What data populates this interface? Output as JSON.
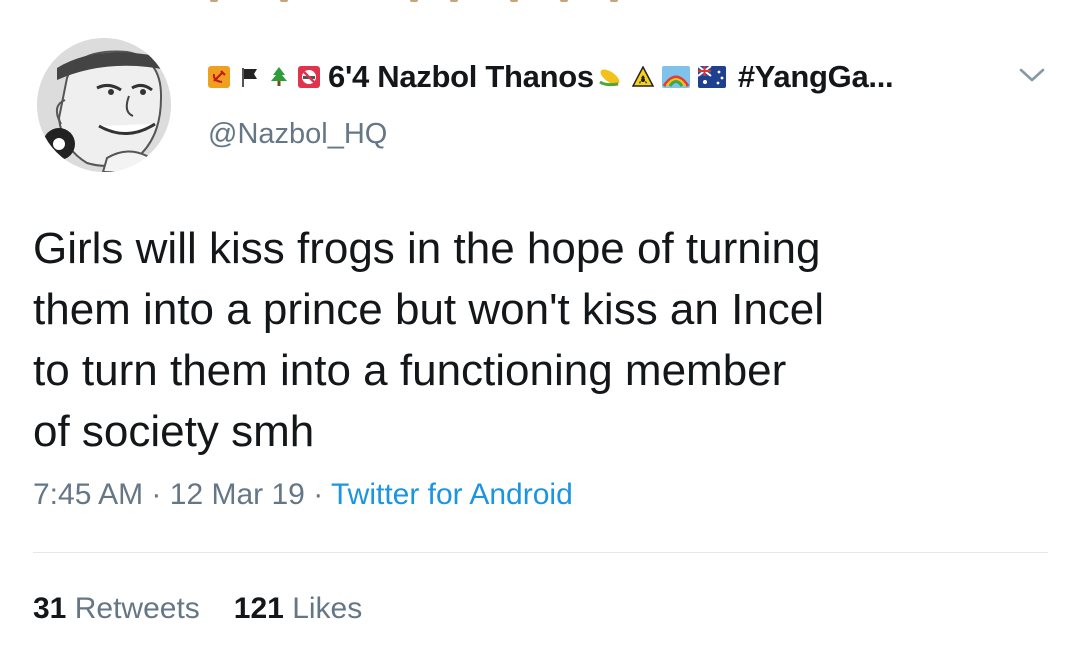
{
  "user": {
    "display_name_prefix_icons": [
      "hammer-sickle-icon",
      "black-flag-icon",
      "tree-icon",
      "no-smoking-icon"
    ],
    "display_name": "6'4 Nazbol Thanos",
    "display_name_suffix_icons": [
      "corn-icon",
      "radioactive-icon",
      "rainbow-icon",
      "australia-flag-icon"
    ],
    "display_name_tail": "#YangGa...",
    "handle": "@Nazbol_HQ"
  },
  "tweet": {
    "text": "Girls will kiss frogs in the hope of turning\nthem into a prince but won't kiss an Incel\nto turn them into a functioning member\nof society smh",
    "time": "7:45 AM",
    "separator": "·",
    "date": "12 Mar 19",
    "source": "Twitter for Android"
  },
  "stats": {
    "retweets_count": "31",
    "retweets_label": "Retweets",
    "likes_count": "121",
    "likes_label": "Likes"
  },
  "colors": {
    "text_primary": "#14171a",
    "text_secondary": "#657786",
    "link": "#1b95e0",
    "divider": "#e1e8ed"
  }
}
